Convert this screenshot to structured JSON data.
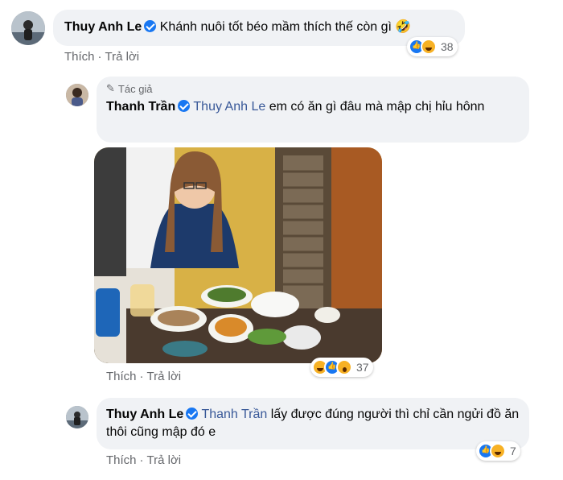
{
  "comments": [
    {
      "author": "Thuy Anh Le",
      "text": "Khánh nuôi tốt béo mầm thích thế còn gì",
      "emoji": "🤣",
      "reaction_count": "38",
      "reactions": [
        "like",
        "haha"
      ],
      "actions": {
        "like": "Thích",
        "separator": "·",
        "reply": "Trả lời"
      }
    },
    {
      "badge": "Tác giả",
      "author": "Thanh Trần",
      "tag": "Thuy Anh Le",
      "text": "em có ăn gì đâu mà mập chị hỉu hônn",
      "reaction_count": "37",
      "reactions": [
        "haha",
        "like",
        "wow"
      ],
      "actions": {
        "like": "Thích",
        "separator": "·",
        "reply": "Trả lời"
      }
    },
    {
      "author": "Thuy Anh Le",
      "tag": "Thanh Trần",
      "text": "lấy được đúng người thì chỉ cần ngửi đồ ăn thôi cũng mập đó e",
      "reaction_count": "7",
      "reactions": [
        "like",
        "haha"
      ],
      "actions": {
        "like": "Thích",
        "separator": "·",
        "reply": "Trả lời"
      }
    }
  ],
  "colors": {
    "bubble": "#f0f2f5",
    "link": "#385898",
    "verified": "#1877f2",
    "muted": "#65676b"
  }
}
